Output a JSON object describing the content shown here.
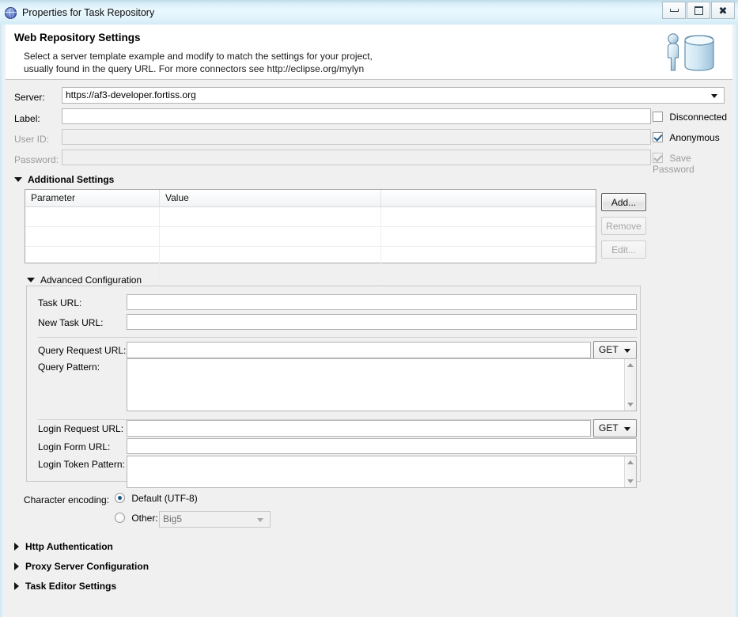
{
  "window": {
    "title": "Properties for Task Repository",
    "icon": "globe-icon",
    "buttons": {
      "minimize": "minimize-icon",
      "maximize": "maximize-icon",
      "close": "close-icon"
    }
  },
  "header": {
    "title": "Web Repository Settings",
    "description_line1": "Select a server template example and modify to match the settings for your project,",
    "description_line2": "usually found in the query URL.  For more connectors see http://eclipse.org/mylyn",
    "artwork": "person-and-database-icon"
  },
  "server_form": {
    "server_label": "Server:",
    "server_value": "https://af3-developer.fortiss.org",
    "label_label": "Label:",
    "label_value": "",
    "userid_label": "User ID:",
    "userid_value": "",
    "password_label": "Password:",
    "password_value": "",
    "checkboxes": [
      {
        "label": "Disconnected",
        "checked": false,
        "enabled": true
      },
      {
        "label": "Anonymous",
        "checked": true,
        "enabled": true
      },
      {
        "label": "Save Password",
        "checked": true,
        "enabled": false
      }
    ]
  },
  "additional_settings": {
    "title": "Additional Settings",
    "expanded": true,
    "columns": [
      "Parameter",
      "Value",
      ""
    ],
    "rows": [],
    "empty_row_count": 4,
    "buttons": [
      {
        "label": "Add...",
        "enabled": true,
        "focused": true
      },
      {
        "label": "Remove",
        "enabled": false,
        "focused": false
      },
      {
        "label": "Edit...",
        "enabled": false,
        "focused": false
      }
    ]
  },
  "advanced_configuration": {
    "title": "Advanced Configuration",
    "expanded": true,
    "task_url_label": "Task URL:",
    "task_url_value": "",
    "new_task_url_label": "New Task URL:",
    "new_task_url_value": "",
    "query_request_url_label": "Query Request URL:",
    "query_request_url_value": "",
    "query_request_method": "GET",
    "query_pattern_label": "Query Pattern:",
    "query_pattern_value": "",
    "login_request_url_label": "Login Request URL:",
    "login_request_url_value": "",
    "login_request_method": "GET",
    "login_form_url_label": "Login Form URL:",
    "login_form_url_value": "",
    "login_token_pattern_label": "Login Token Pattern:",
    "login_token_pattern_value": ""
  },
  "character_encoding": {
    "label": "Character encoding:",
    "default_option": "Default (UTF-8)",
    "default_selected": true,
    "other_option": "Other:",
    "other_selected": false,
    "other_value": "Big5",
    "other_enabled": false
  },
  "collapsed_sections": [
    {
      "label": "Http Authentication",
      "expanded": false
    },
    {
      "label": "Proxy Server Configuration",
      "expanded": false
    },
    {
      "label": "Task Editor Settings",
      "expanded": false
    }
  ],
  "colors": {
    "dialog_background": "#f0f0f0",
    "header_background": "#ffffff",
    "titlebar_accent": "#d9edf7",
    "field_border": "#b4b4b4",
    "disabled_text": "#9b9b9b"
  }
}
